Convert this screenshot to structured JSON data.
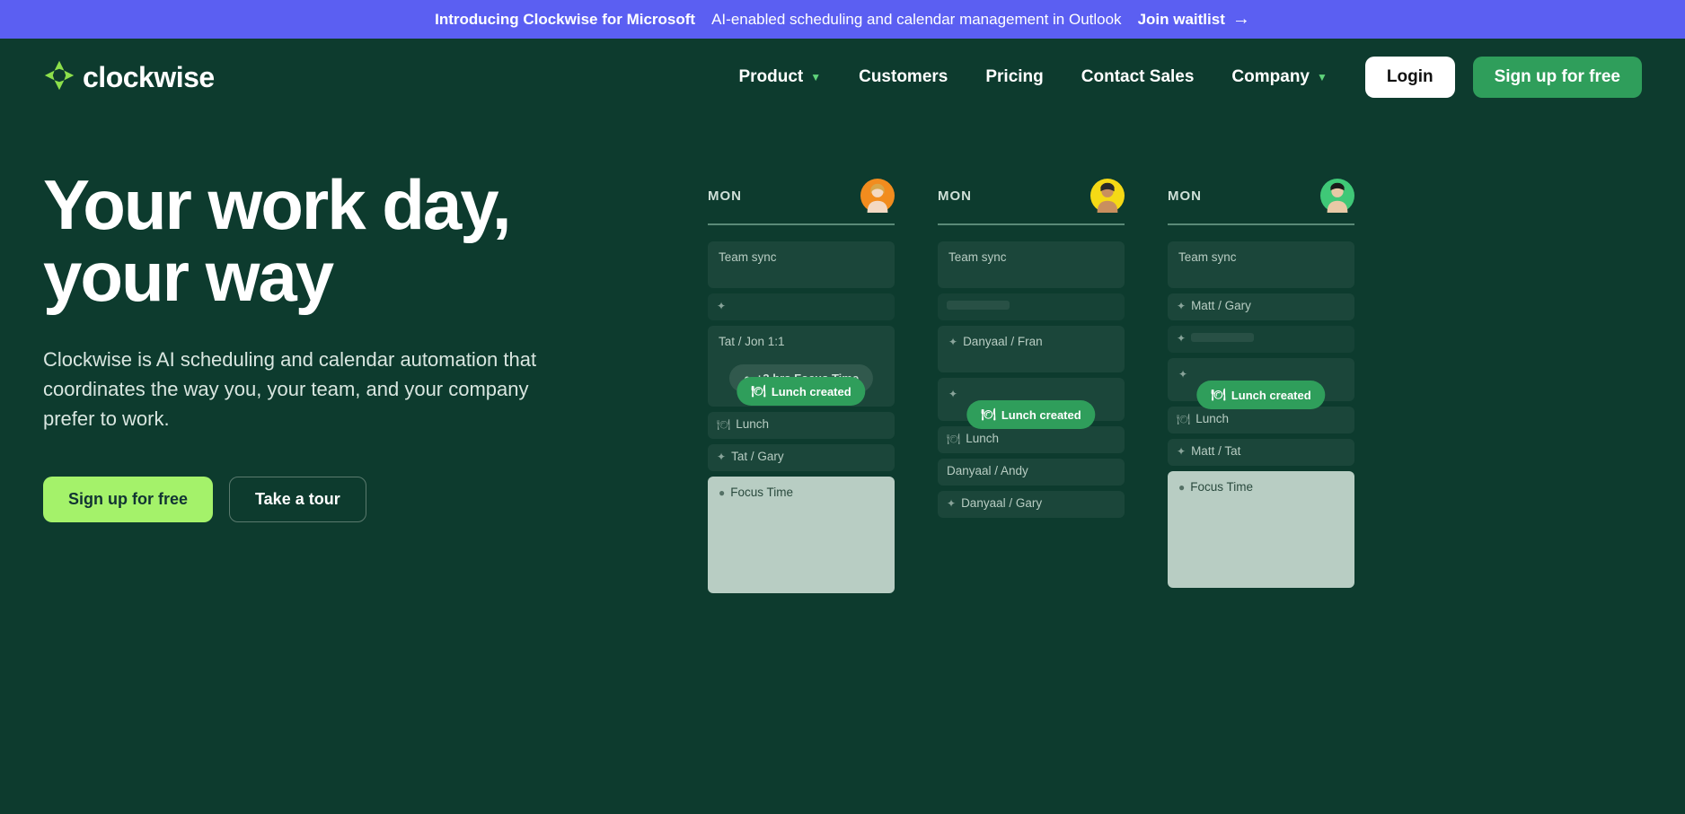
{
  "announce": {
    "bold": "Introducing Clockwise for Microsoft",
    "text": "AI-enabled scheduling and calendar management in Outlook",
    "cta": "Join waitlist"
  },
  "brand": {
    "name": "clockwise"
  },
  "nav": {
    "product": "Product",
    "customers": "Customers",
    "pricing": "Pricing",
    "contact": "Contact Sales",
    "company": "Company"
  },
  "actions": {
    "login": "Login",
    "signup": "Sign up for free"
  },
  "hero": {
    "h1a": "Your work day,",
    "h1b": "your way",
    "sub": "Clockwise is AI scheduling and calendar automation that coordinates the way you, your team, and your company prefer to work.",
    "cta1": "Sign up for free",
    "cta2": "Take a tour"
  },
  "cal": {
    "day": "MON",
    "avatars": [
      {
        "bg": "#f28c1e"
      },
      {
        "bg": "#f5d915"
      },
      {
        "bg": "#3fc877"
      }
    ],
    "pills": {
      "focus": "+3 hrs Focus Time",
      "lunch": "Lunch created"
    },
    "col1": {
      "e1": "Team sync",
      "e3": "Tat / Jon 1:1",
      "e5": "Lunch",
      "e6": "Tat / Gary",
      "e7": "Focus Time"
    },
    "col2": {
      "e1": "Team sync",
      "e3": "Danyaal / Fran",
      "e5": "Lunch",
      "e6": "Danyaal / Andy",
      "e7": "Danyaal / Gary"
    },
    "col3": {
      "e1": "Team sync",
      "e2": "Matt / Gary",
      "e5": "Lunch",
      "e6": "Matt / Tat",
      "e7": "Focus Time"
    }
  }
}
